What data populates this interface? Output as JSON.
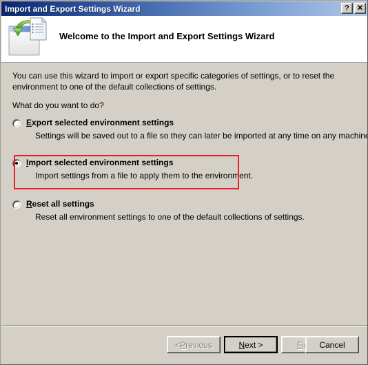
{
  "window": {
    "title": "Import and Export Settings Wizard",
    "help_button": "?",
    "close_button": "✕"
  },
  "header": {
    "title": "Welcome to the Import and Export Settings Wizard",
    "icon": "import-export-settings-icon"
  },
  "body": {
    "intro": "You can use this wizard to import or export specific categories of settings, or to reset the environment to one of the default collections of settings.",
    "question": "What do you want to do?",
    "options": [
      {
        "id": "export",
        "accesskey": "E",
        "label_before": "",
        "label_after": "xport selected environment settings",
        "description": "Settings will be saved out to a file so they can later be imported at any time on any machine.",
        "selected": false,
        "highlighted": false
      },
      {
        "id": "import",
        "accesskey": "I",
        "label_before": "",
        "label_after": "mport selected environment settings",
        "description": "Import settings from a file to apply them to the environment.",
        "selected": true,
        "highlighted": true
      },
      {
        "id": "reset",
        "accesskey": "R",
        "label_before": "",
        "label_after": "eset all settings",
        "description": "Reset all environment settings to one of the default collections of settings.",
        "selected": false,
        "highlighted": false
      }
    ]
  },
  "buttons": {
    "previous": {
      "prefix": "< ",
      "accesskey": "P",
      "suffix": "revious",
      "disabled": true,
      "default": false
    },
    "next": {
      "prefix": "",
      "accesskey": "N",
      "suffix": "ext >",
      "disabled": false,
      "default": true
    },
    "finish": {
      "prefix": "",
      "accesskey": "F",
      "suffix": "inish",
      "disabled": true,
      "default": false
    },
    "cancel": {
      "prefix": "",
      "accesskey": "",
      "suffix": "Cancel",
      "disabled": false,
      "default": false
    }
  },
  "colors": {
    "titlebar_start": "#0a246a",
    "titlebar_end": "#b9cbe8",
    "dialog_face": "#d4d0c8",
    "header_background": "#ffffff",
    "annotation_red": "#e81e22",
    "icon_green": "#7bc043",
    "icon_blue": "#5b8fd0"
  }
}
